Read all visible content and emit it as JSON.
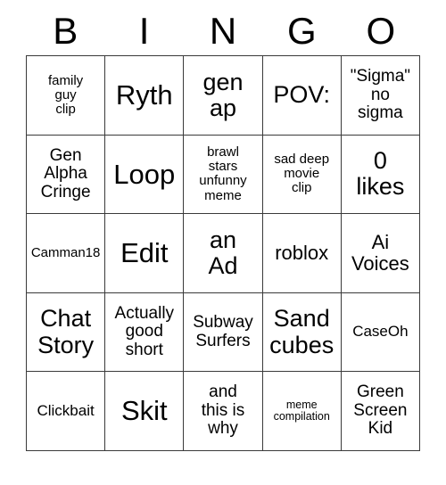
{
  "card": {
    "headers": [
      "B",
      "I",
      "N",
      "G",
      "O"
    ],
    "rows": [
      [
        {
          "text": "family\nguy\nclip",
          "size": "s"
        },
        {
          "text": "Ryth",
          "size": "xxl"
        },
        {
          "text": "gen\nap",
          "size": "xl"
        },
        {
          "text": "POV:",
          "size": "xl"
        },
        {
          "text": "\"Sigma\"\nno\nsigma",
          "size": "ml"
        }
      ],
      [
        {
          "text": "Gen\nAlpha\nCringe",
          "size": "ml"
        },
        {
          "text": "Loop",
          "size": "xxl"
        },
        {
          "text": "brawl\nstars\nunfunny\nmeme",
          "size": "s"
        },
        {
          "text": "sad deep\nmovie\nclip",
          "size": "s"
        },
        {
          "text": "0\nlikes",
          "size": "xl"
        }
      ],
      [
        {
          "text": "Camman18",
          "size": "s"
        },
        {
          "text": "Edit",
          "size": "xxl"
        },
        {
          "text": "an\nAd",
          "size": "xl"
        },
        {
          "text": "roblox",
          "size": "l"
        },
        {
          "text": "Ai\nVoices",
          "size": "l"
        }
      ],
      [
        {
          "text": "Chat\nStory",
          "size": "xl"
        },
        {
          "text": "Actually\ngood\nshort",
          "size": "ml"
        },
        {
          "text": "Subway\nSurfers",
          "size": "ml"
        },
        {
          "text": "Sand\ncubes",
          "size": "xl"
        },
        {
          "text": "CaseOh",
          "size": "m"
        }
      ],
      [
        {
          "text": "Clickbait",
          "size": "m"
        },
        {
          "text": "Skit",
          "size": "xxl"
        },
        {
          "text": "and\nthis is\nwhy",
          "size": "ml"
        },
        {
          "text": "meme\ncompilation",
          "size": "xs"
        },
        {
          "text": "Green\nScreen\nKid",
          "size": "ml"
        }
      ]
    ]
  },
  "colors": {
    "background": "#ffffff",
    "text": "#000000",
    "grid_line": "#3a3a3a"
  }
}
